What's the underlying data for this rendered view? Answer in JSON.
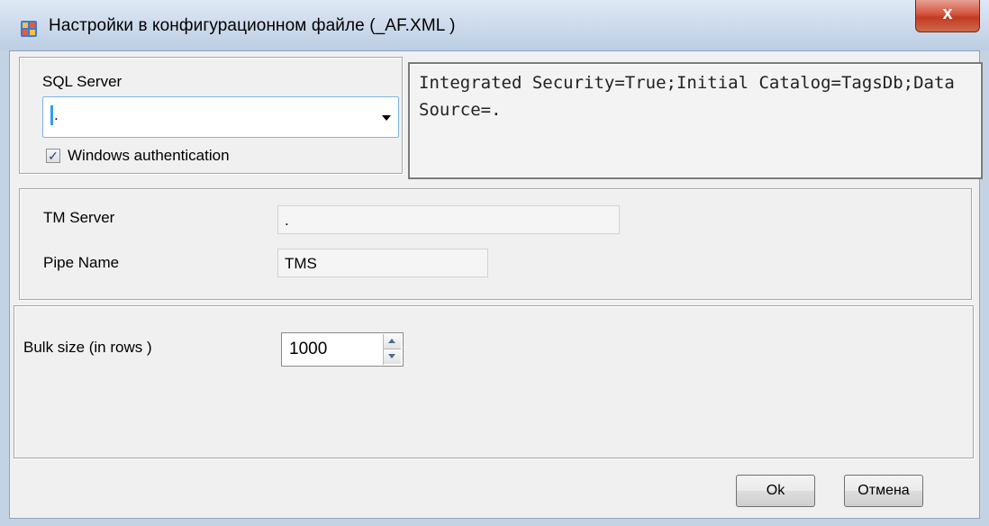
{
  "window": {
    "title": "Настройки в конфигурационном файле (_AF.XML )",
    "close_label": "x"
  },
  "sql_group": {
    "label": "SQL Server",
    "combo_value": ".",
    "windows_auth_label": "Windows authentication",
    "windows_auth_checked": true,
    "connection_string": "Integrated Security=True;Initial Catalog=TagsDb;Data Source=."
  },
  "tm_group": {
    "server_label": "TM Server",
    "server_value": ".",
    "pipe_label": "Pipe Name",
    "pipe_value": "TMS"
  },
  "bulk_group": {
    "label": "Bulk size (in rows )",
    "value": "1000"
  },
  "buttons": {
    "ok": "Ok",
    "cancel": "Отмена"
  }
}
